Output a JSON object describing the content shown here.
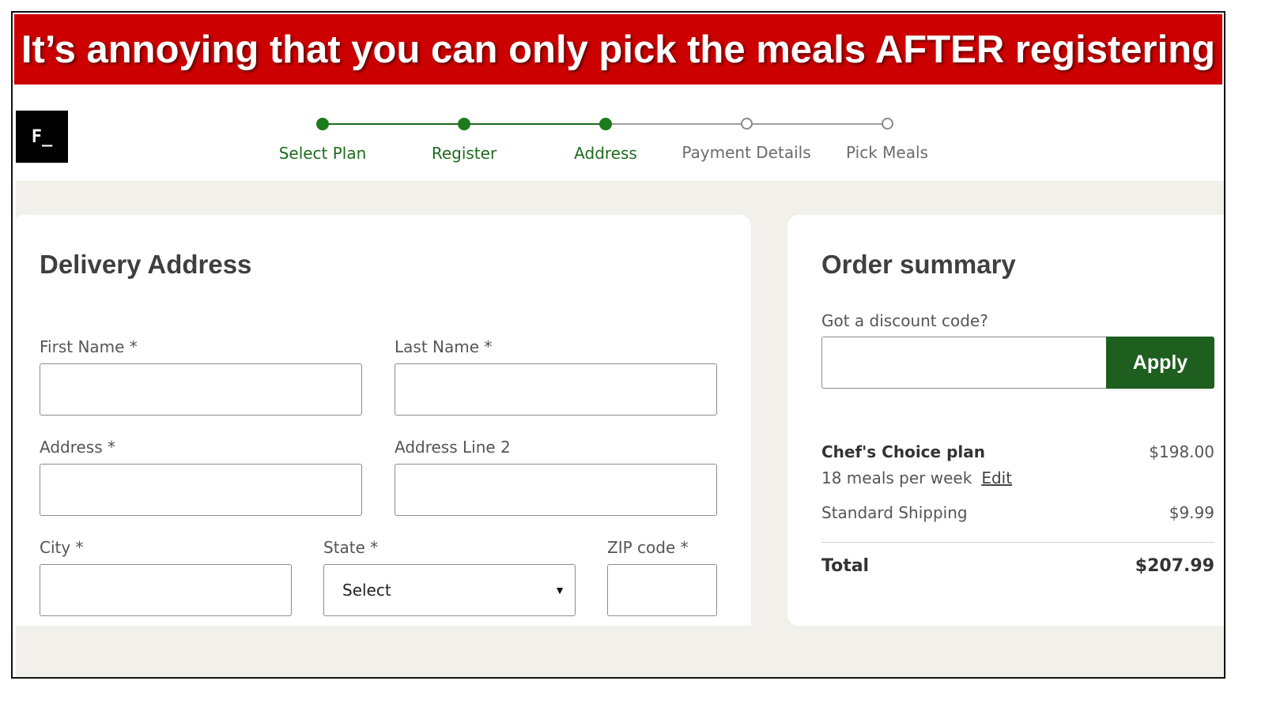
{
  "banner": {
    "text": "It’s annoying that you can only pick the meals AFTER registering"
  },
  "logo": {
    "text": "F_"
  },
  "steps": [
    {
      "label": "Select Plan",
      "state": "complete"
    },
    {
      "label": "Register",
      "state": "complete"
    },
    {
      "label": "Address",
      "state": "current"
    },
    {
      "label": "Payment Details",
      "state": "pending"
    },
    {
      "label": "Pick Meals",
      "state": "pending"
    }
  ],
  "delivery": {
    "title": "Delivery Address",
    "first_name_label": "First Name *",
    "last_name_label": "Last Name *",
    "address_label": "Address *",
    "address2_label": "Address Line 2",
    "city_label": "City *",
    "state_label": "State *",
    "state_selected": "Select",
    "zip_label": "ZIP code *"
  },
  "summary": {
    "title": "Order summary",
    "discount_label": "Got a discount code?",
    "apply_label": "Apply",
    "plan_name": "Chef's Choice plan",
    "plan_price": "$198.00",
    "plan_detail": "18 meals per week",
    "edit_label": "Edit",
    "shipping_label": "Standard Shipping",
    "shipping_price": "$9.99",
    "total_label": "Total",
    "total_price": "$207.99"
  },
  "colors": {
    "accent_green": "#1e6b1e",
    "banner_red": "#cc0000",
    "pending_grey": "#6b6b6b"
  },
  "icons": {
    "state_select": "caret-down-icon"
  }
}
